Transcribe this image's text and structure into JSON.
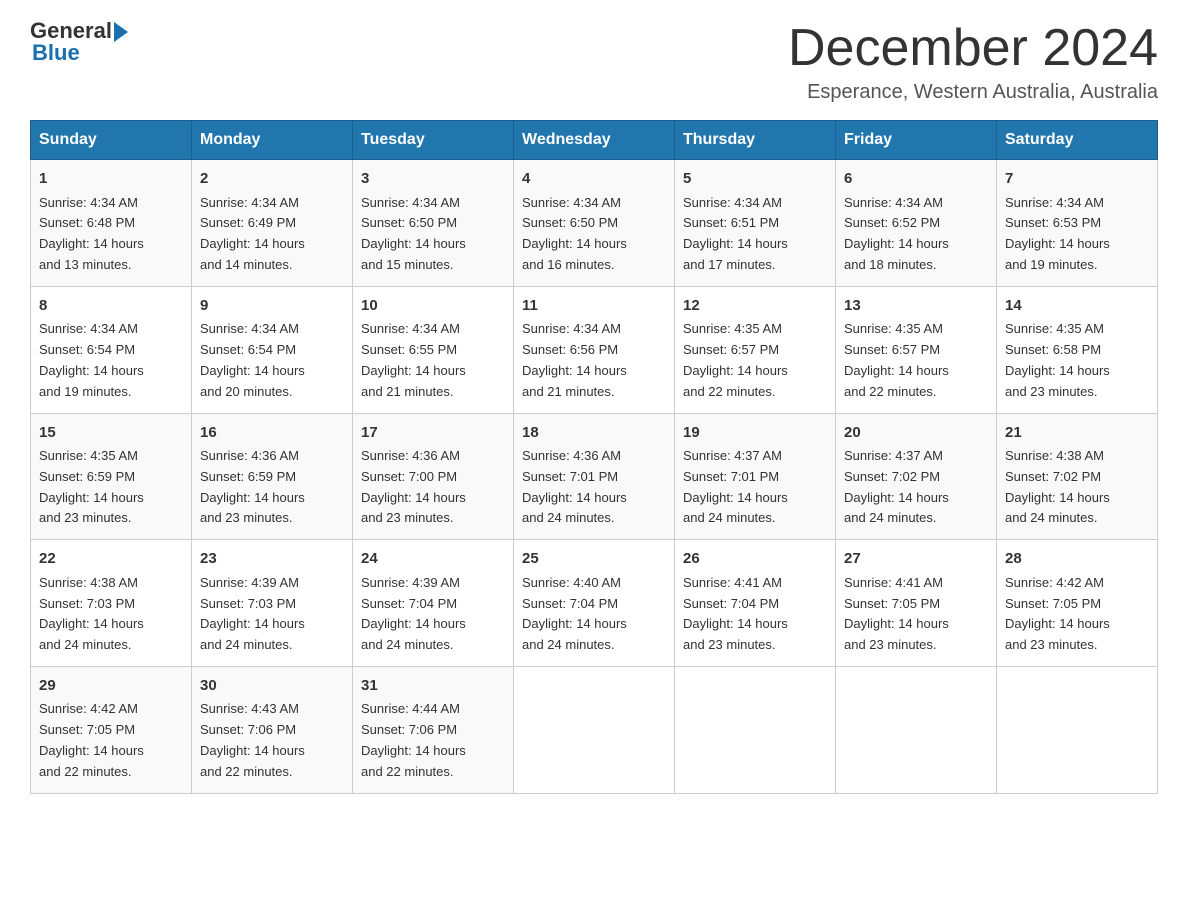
{
  "logo": {
    "text_general": "General",
    "triangle": "▶",
    "text_blue": "Blue"
  },
  "title": "December 2024",
  "location": "Esperance, Western Australia, Australia",
  "days_of_week": [
    "Sunday",
    "Monday",
    "Tuesday",
    "Wednesday",
    "Thursday",
    "Friday",
    "Saturday"
  ],
  "weeks": [
    [
      {
        "day": "1",
        "sunrise": "4:34 AM",
        "sunset": "6:48 PM",
        "daylight": "14 hours and 13 minutes."
      },
      {
        "day": "2",
        "sunrise": "4:34 AM",
        "sunset": "6:49 PM",
        "daylight": "14 hours and 14 minutes."
      },
      {
        "day": "3",
        "sunrise": "4:34 AM",
        "sunset": "6:50 PM",
        "daylight": "14 hours and 15 minutes."
      },
      {
        "day": "4",
        "sunrise": "4:34 AM",
        "sunset": "6:50 PM",
        "daylight": "14 hours and 16 minutes."
      },
      {
        "day": "5",
        "sunrise": "4:34 AM",
        "sunset": "6:51 PM",
        "daylight": "14 hours and 17 minutes."
      },
      {
        "day": "6",
        "sunrise": "4:34 AM",
        "sunset": "6:52 PM",
        "daylight": "14 hours and 18 minutes."
      },
      {
        "day": "7",
        "sunrise": "4:34 AM",
        "sunset": "6:53 PM",
        "daylight": "14 hours and 19 minutes."
      }
    ],
    [
      {
        "day": "8",
        "sunrise": "4:34 AM",
        "sunset": "6:54 PM",
        "daylight": "14 hours and 19 minutes."
      },
      {
        "day": "9",
        "sunrise": "4:34 AM",
        "sunset": "6:54 PM",
        "daylight": "14 hours and 20 minutes."
      },
      {
        "day": "10",
        "sunrise": "4:34 AM",
        "sunset": "6:55 PM",
        "daylight": "14 hours and 21 minutes."
      },
      {
        "day": "11",
        "sunrise": "4:34 AM",
        "sunset": "6:56 PM",
        "daylight": "14 hours and 21 minutes."
      },
      {
        "day": "12",
        "sunrise": "4:35 AM",
        "sunset": "6:57 PM",
        "daylight": "14 hours and 22 minutes."
      },
      {
        "day": "13",
        "sunrise": "4:35 AM",
        "sunset": "6:57 PM",
        "daylight": "14 hours and 22 minutes."
      },
      {
        "day": "14",
        "sunrise": "4:35 AM",
        "sunset": "6:58 PM",
        "daylight": "14 hours and 23 minutes."
      }
    ],
    [
      {
        "day": "15",
        "sunrise": "4:35 AM",
        "sunset": "6:59 PM",
        "daylight": "14 hours and 23 minutes."
      },
      {
        "day": "16",
        "sunrise": "4:36 AM",
        "sunset": "6:59 PM",
        "daylight": "14 hours and 23 minutes."
      },
      {
        "day": "17",
        "sunrise": "4:36 AM",
        "sunset": "7:00 PM",
        "daylight": "14 hours and 23 minutes."
      },
      {
        "day": "18",
        "sunrise": "4:36 AM",
        "sunset": "7:01 PM",
        "daylight": "14 hours and 24 minutes."
      },
      {
        "day": "19",
        "sunrise": "4:37 AM",
        "sunset": "7:01 PM",
        "daylight": "14 hours and 24 minutes."
      },
      {
        "day": "20",
        "sunrise": "4:37 AM",
        "sunset": "7:02 PM",
        "daylight": "14 hours and 24 minutes."
      },
      {
        "day": "21",
        "sunrise": "4:38 AM",
        "sunset": "7:02 PM",
        "daylight": "14 hours and 24 minutes."
      }
    ],
    [
      {
        "day": "22",
        "sunrise": "4:38 AM",
        "sunset": "7:03 PM",
        "daylight": "14 hours and 24 minutes."
      },
      {
        "day": "23",
        "sunrise": "4:39 AM",
        "sunset": "7:03 PM",
        "daylight": "14 hours and 24 minutes."
      },
      {
        "day": "24",
        "sunrise": "4:39 AM",
        "sunset": "7:04 PM",
        "daylight": "14 hours and 24 minutes."
      },
      {
        "day": "25",
        "sunrise": "4:40 AM",
        "sunset": "7:04 PM",
        "daylight": "14 hours and 24 minutes."
      },
      {
        "day": "26",
        "sunrise": "4:41 AM",
        "sunset": "7:04 PM",
        "daylight": "14 hours and 23 minutes."
      },
      {
        "day": "27",
        "sunrise": "4:41 AM",
        "sunset": "7:05 PM",
        "daylight": "14 hours and 23 minutes."
      },
      {
        "day": "28",
        "sunrise": "4:42 AM",
        "sunset": "7:05 PM",
        "daylight": "14 hours and 23 minutes."
      }
    ],
    [
      {
        "day": "29",
        "sunrise": "4:42 AM",
        "sunset": "7:05 PM",
        "daylight": "14 hours and 22 minutes."
      },
      {
        "day": "30",
        "sunrise": "4:43 AM",
        "sunset": "7:06 PM",
        "daylight": "14 hours and 22 minutes."
      },
      {
        "day": "31",
        "sunrise": "4:44 AM",
        "sunset": "7:06 PM",
        "daylight": "14 hours and 22 minutes."
      },
      null,
      null,
      null,
      null
    ]
  ],
  "labels": {
    "sunrise": "Sunrise:",
    "sunset": "Sunset:",
    "daylight": "Daylight:"
  }
}
